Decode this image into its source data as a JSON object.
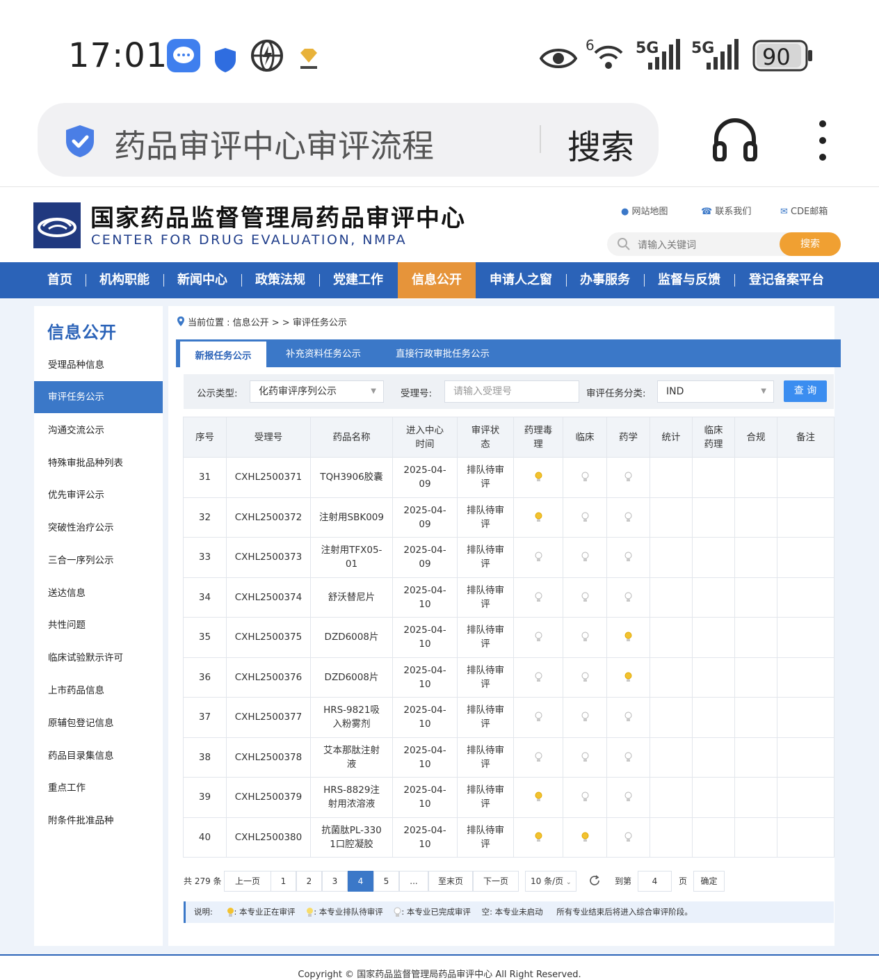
{
  "status_bar": {
    "time": "17:01",
    "battery": "90",
    "net1": "5G",
    "net2": "5G",
    "wifi_label": "6"
  },
  "browser": {
    "query": "药品审评中心审评流程",
    "search_btn": "搜索"
  },
  "site": {
    "title": "国家药品监督管理局药品审评中心",
    "subtitle": "CENTER FOR DRUG EVALUATION, NMPA",
    "links": [
      "网站地图",
      "联系我们",
      "CDE邮箱"
    ],
    "search_placeholder": "请输入关键词",
    "search_btn": "搜索"
  },
  "nav": [
    "首页",
    "机构职能",
    "新闻中心",
    "政策法规",
    "党建工作",
    "信息公开",
    "申请人之窗",
    "办事服务",
    "监督与反馈",
    "登记备案平台"
  ],
  "sidebar": {
    "title": "信息公开",
    "items": [
      "受理品种信息",
      "审评任务公示",
      "沟通交流公示",
      "特殊审批品种列表",
      "优先审评公示",
      "突破性治疗公示",
      "三合一序列公示",
      "送达信息",
      "共性问题",
      "临床试验默示许可",
      "上市药品信息",
      "原辅包登记信息",
      "药品目录集信息",
      "重点工作",
      "附条件批准品种"
    ]
  },
  "breadcrumb": "当前位置 : 信息公开 > > 审评任务公示",
  "tabs": [
    "新报任务公示",
    "补充资料任务公示",
    "直接行政审批任务公示"
  ],
  "filter": {
    "type_label": "公示类型:",
    "type_value": "化药审评序列公示",
    "accept_label": "受理号:",
    "accept_placeholder": "请输入受理号",
    "category_label": "审评任务分类:",
    "category_value": "IND",
    "query_btn": "查 询"
  },
  "table": {
    "headers": [
      "序号",
      "受理号",
      "药品名称",
      "进入中心时间",
      "审评状态",
      "药理毒理",
      "临床",
      "药学",
      "统计",
      "临床药理",
      "合规",
      "备注"
    ],
    "rows": [
      {
        "no": "31",
        "id": "CXHL2500371",
        "name": "TQH3906胶囊",
        "date": "2025-04-09",
        "status": "排队待审评",
        "lights": [
          "queue",
          "done",
          "done"
        ]
      },
      {
        "no": "32",
        "id": "CXHL2500372",
        "name": "注射用SBK009",
        "date": "2025-04-09",
        "status": "排队待审评",
        "lights": [
          "queue",
          "done",
          "done"
        ]
      },
      {
        "no": "33",
        "id": "CXHL2500373",
        "name": "注射用TFX05-01",
        "date": "2025-04-09",
        "status": "排队待审评",
        "lights": [
          "done",
          "done",
          "done"
        ]
      },
      {
        "no": "34",
        "id": "CXHL2500374",
        "name": "舒沃替尼片",
        "date": "2025-04-10",
        "status": "排队待审评",
        "lights": [
          "done",
          "done",
          "done"
        ]
      },
      {
        "no": "35",
        "id": "CXHL2500375",
        "name": "DZD6008片",
        "date": "2025-04-10",
        "status": "排队待审评",
        "lights": [
          "done",
          "done",
          "queue"
        ]
      },
      {
        "no": "36",
        "id": "CXHL2500376",
        "name": "DZD6008片",
        "date": "2025-04-10",
        "status": "排队待审评",
        "lights": [
          "done",
          "done",
          "queue"
        ]
      },
      {
        "no": "37",
        "id": "CXHL2500377",
        "name": "HRS-9821吸入粉雾剂",
        "date": "2025-04-10",
        "status": "排队待审评",
        "lights": [
          "done",
          "done",
          "done"
        ]
      },
      {
        "no": "38",
        "id": "CXHL2500378",
        "name": "艾本那肽注射液",
        "date": "2025-04-10",
        "status": "排队待审评",
        "lights": [
          "done",
          "done",
          "done"
        ]
      },
      {
        "no": "39",
        "id": "CXHL2500379",
        "name": "HRS-8829注射用浓溶液",
        "date": "2025-04-10",
        "status": "排队待审评",
        "lights": [
          "queue",
          "done",
          "done"
        ]
      },
      {
        "no": "40",
        "id": "CXHL2500380",
        "name": "抗菌肽PL-3301口腔凝胶",
        "date": "2025-04-10",
        "status": "排队待审评",
        "lights": [
          "queue",
          "queue",
          "done"
        ]
      }
    ]
  },
  "pagination": {
    "total": "共 279 条",
    "prev": "上一页",
    "pages": [
      "1",
      "2",
      "3",
      "4",
      "5",
      "..."
    ],
    "current": "4",
    "last": "至末页",
    "next": "下一页",
    "size": "10 条/页",
    "goto": "到第",
    "goto_value": "4",
    "page_unit": "页",
    "confirm": "确定"
  },
  "legend": {
    "label": "说明:",
    "active": ": 本专业正在审评",
    "queue": ": 本专业排队待审评",
    "done": ": 本专业已完成审评",
    "empty": "空: 本专业未启动",
    "note": "所有专业结束后将进入综合审评阶段。"
  },
  "footer": "Copyright © 国家药品监督管理局药品审评中心   All Right Reserved.",
  "colors": {
    "nav": "#2b63b8",
    "nav_active": "#e6943a",
    "accent": "#3b78c8",
    "search_btn": "#f0a032",
    "bulb_queue": "#f2c230",
    "bulb_done": "#cfcfcf"
  }
}
